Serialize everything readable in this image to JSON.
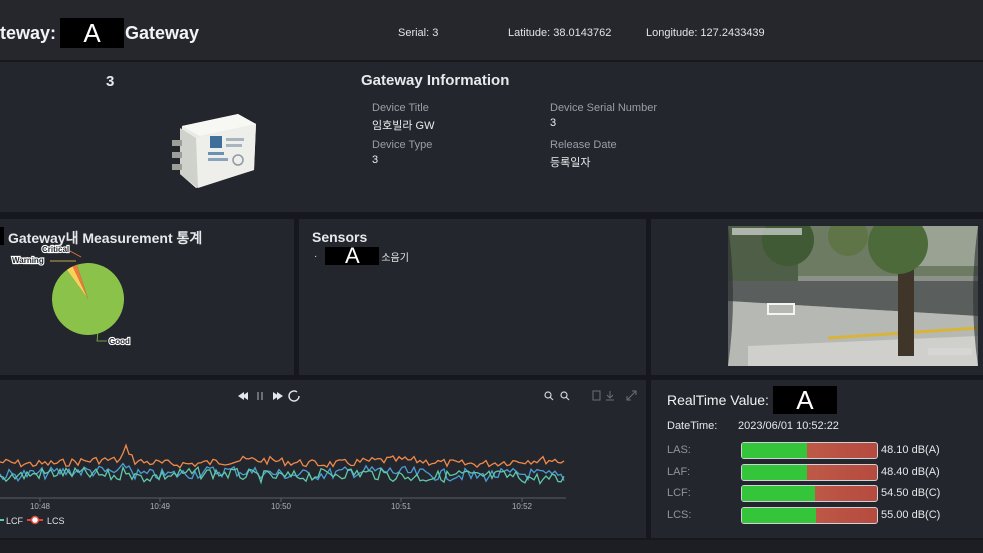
{
  "header": {
    "title_prefix": "teway:",
    "title_redacted": "A",
    "title_suffix": "Gateway",
    "serial": "Serial: 3",
    "latitude": "Latitude: 38.0143762",
    "longitude": "Longitude: 127.2433439"
  },
  "gateway_info": {
    "number": "3",
    "title": "Gateway Information",
    "fields": {
      "device_title_label": "Device Title",
      "device_title_value": "임호빌라 GW",
      "device_serial_label": "Device Serial Number",
      "device_serial_value": "3",
      "device_type_label": "Device Type",
      "device_type_value": "3",
      "release_date_label": "Release Date",
      "release_date_value": "등록일자"
    }
  },
  "stats": {
    "title": "Gateway내 Measurement 통계",
    "pie_labels": {
      "critical": "Critical",
      "warning": "Warning",
      "good": "Good"
    }
  },
  "chart_data": {
    "type": "pie",
    "title": "Gateway내 Measurement 통계",
    "categories": [
      "Good",
      "Warning",
      "Critical"
    ],
    "values": [
      95,
      3,
      2
    ],
    "colors": [
      "#8bc34a",
      "#f7d25a",
      "#ee7a3a"
    ]
  },
  "sensors": {
    "title": "Sensors",
    "bullet": "·",
    "item_redacted": "A",
    "item_suffix": "소음기"
  },
  "trend_chart": {
    "type": "line",
    "x_ticks": [
      "10:48",
      "10:49",
      "10:50",
      "10:51",
      "10:52"
    ],
    "legend": [
      "LCF",
      "LCS"
    ],
    "series_colors": [
      "#f08a4b",
      "#4b9ed8",
      "#5fc9a8"
    ]
  },
  "realtime": {
    "title": "RealTime Value:",
    "title_redacted": "A",
    "datetime_label": "DateTime:",
    "datetime_value": "2023/06/01 10:52:22",
    "levels": [
      {
        "label": "LAS:",
        "value": "48.10 dB(A)",
        "fill": 0.48
      },
      {
        "label": "LAF:",
        "value": "48.40 dB(A)",
        "fill": 0.48
      },
      {
        "label": "LCF:",
        "value": "54.50 dB(C)",
        "fill": 0.54
      },
      {
        "label": "LCS:",
        "value": "55.00 dB(C)",
        "fill": 0.55
      }
    ]
  }
}
